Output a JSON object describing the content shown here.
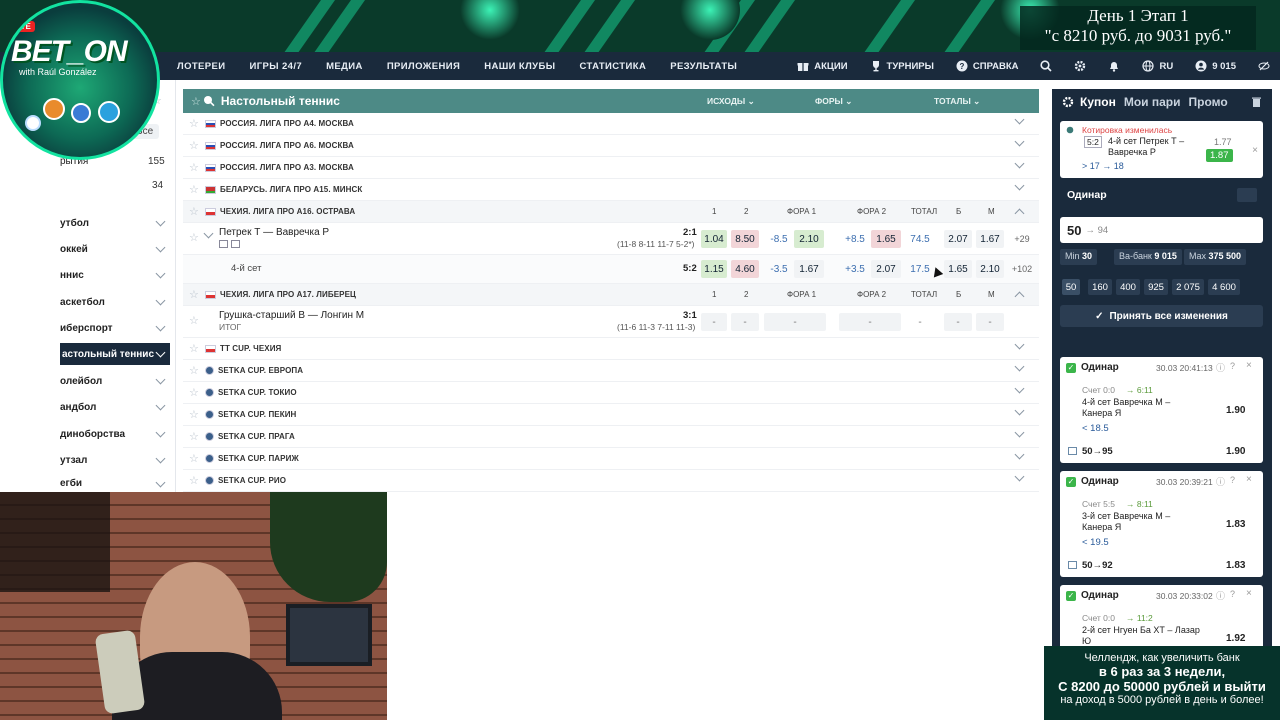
{
  "overlay": {
    "logo_text": "BET_ON",
    "logo_sub": "with Raúl González",
    "live_badge": "LIVE",
    "challenge_line1": "День 1  Этап 1",
    "challenge_line2": "\"с 8210 руб. до 9031 руб.\"",
    "promo_line1": "Челлендж, как увеличить банк",
    "promo_line2": "в 6 раз за 3 недели,",
    "promo_line3": "С 8200 до 50000 рублей и выйти",
    "promo_line4": "на доход в 5000 рублей в день и более!"
  },
  "nav": {
    "items": [
      "ЛОТЕРЕИ",
      "ИГРЫ 24/7",
      "МЕДИА",
      "ПРИЛОЖЕНИЯ",
      "НАШИ КЛУБЫ",
      "СТАТИСТИКА",
      "РЕЗУЛЬТАТЫ"
    ],
    "promo": "АКЦИИ",
    "tournaments": "ТУРНИРЫ",
    "help": "СПРАВКА",
    "lang": "RU",
    "balance": "9 015",
    "colors": {
      "bg": "#1a2a3c",
      "accent": "#4d8a86"
    }
  },
  "sidebar": {
    "all_label": "Все",
    "open_label": "рытия",
    "open_count": "155",
    "second_count": "34",
    "sports": [
      {
        "label": "утбол",
        "active": false
      },
      {
        "label": "оккей",
        "active": false
      },
      {
        "label": "ннис",
        "active": false
      },
      {
        "label": "аскетбол",
        "active": false
      },
      {
        "label": "иберспорт",
        "active": false
      },
      {
        "label": "астольный теннис",
        "active": true
      },
      {
        "label": "олейбол",
        "active": false
      },
      {
        "label": "андбол",
        "active": false
      },
      {
        "label": "диноборства",
        "active": false
      },
      {
        "label": "утзал",
        "active": false
      },
      {
        "label": "егби",
        "active": false
      }
    ]
  },
  "main": {
    "title": "Настольный теннис",
    "filters": {
      "outcomes": "ИСХОДЫ",
      "handicaps": "ФОРЫ",
      "totals": "ТОТАЛЫ"
    },
    "leagues_top": [
      "РОССИЯ. ЛИГА ПРО А4. МОСКВА",
      "РОССИЯ. ЛИГА ПРО А6. МОСКВА",
      "РОССИЯ. ЛИГА ПРО А3. МОСКВА",
      "БЕЛАРУСЬ. ЛИГА ПРО А15. МИНСК"
    ],
    "league_a16": "ЧЕХИЯ. ЛИГА ПРО А16. ОСТРАВА",
    "col_headers": {
      "c1": "1",
      "c2": "2",
      "h1": "ФОРА 1",
      "h2": "ФОРА 2",
      "total": "ТОТАЛ",
      "b": "Б",
      "m": "М"
    },
    "match1": {
      "teams": "Петрек Т — Вавречка Р",
      "score": "2:1",
      "sets": "(11-8 8-11 11-7 5-2*)",
      "odds": {
        "w1": "1.04",
        "w2": "8.50",
        "h1v": "-8.5",
        "h1": "2.10",
        "h2v": "+8.5",
        "h2": "1.65",
        "tv": "74.5",
        "b": "2.07",
        "m": "1.67",
        "more": "+29"
      }
    },
    "match1_sub": {
      "label": "4-й сет",
      "score": "5:2",
      "odds": {
        "w1": "1.15",
        "w2": "4.60",
        "h1v": "-3.5",
        "h1": "1.67",
        "h2v": "+3.5",
        "h2": "2.07",
        "tv": "17.5",
        "b": "1.65",
        "m": "2.10",
        "more": "+102"
      }
    },
    "league_a17": "ЧЕХИЯ. ЛИГА ПРО А17. ЛИБЕРЕЦ",
    "match2": {
      "teams": "Грушка-старший В — Лонгин М",
      "sub": "ИТОГ",
      "score": "3:1",
      "sets": "(11-6 11-3 7-11 11-3)",
      "dash": "-"
    },
    "leagues_bottom": [
      "TT CUP. ЧЕХИЯ",
      "SETKA CUP. ЕВРОПА",
      "SETKA CUP. ТОКИО",
      "SETKA CUP. ПЕКИН",
      "SETKA CUP. ПРАГА",
      "SETKA CUP. ПАРИЖ",
      "SETKA CUP. РИО"
    ]
  },
  "coupon": {
    "tabs": [
      "Купон",
      "Мои пари",
      "Промо"
    ],
    "changed_label": "Котировка изменилась",
    "changed_score": "5:2",
    "changed_event": "4-й сет Петрек Т – Вавречка Р",
    "changed_line": "> 17 → 18",
    "changed_old": "1.77",
    "changed_new": "1.87",
    "bet_type": "Одинар",
    "stake": "50",
    "stake_next": "→ 94",
    "min_label": "Min",
    "min_value": "30",
    "vabank_label": "Ва-банк",
    "vabank_value": "9 015",
    "max_label": "Max",
    "max_value": "375 500",
    "chips": [
      "50",
      "160",
      "400",
      "925",
      "2 075",
      "4 600"
    ],
    "accept_all": "Принять все изменения",
    "history": [
      {
        "type": "Одинар",
        "time": "30.03 20:41:13",
        "score_from": "Счет 0:0",
        "score_to": "→ 6:11",
        "event": "4-й сет Вавречка М – Канера Я",
        "line": "< 18.5",
        "odd": "1.90",
        "stake": "50→95",
        "total": "1.90"
      },
      {
        "type": "Одинар",
        "time": "30.03 20:39:21",
        "score_from": "Счет 5:5",
        "score_to": "→ 8:11",
        "event": "3-й сет Вавречка М – Канера Я",
        "line": "< 19.5",
        "odd": "1.83",
        "stake": "50→92",
        "total": "1.83"
      },
      {
        "type": "Одинар",
        "time": "30.03 20:33:02",
        "score_from": "Счет 0:0",
        "score_to": "→ 11:2",
        "event": "2-й сет Нгуен Ба ХТ – Лазар Ю",
        "line": "",
        "odd": "1.92",
        "stake": "",
        "total": ""
      }
    ]
  }
}
